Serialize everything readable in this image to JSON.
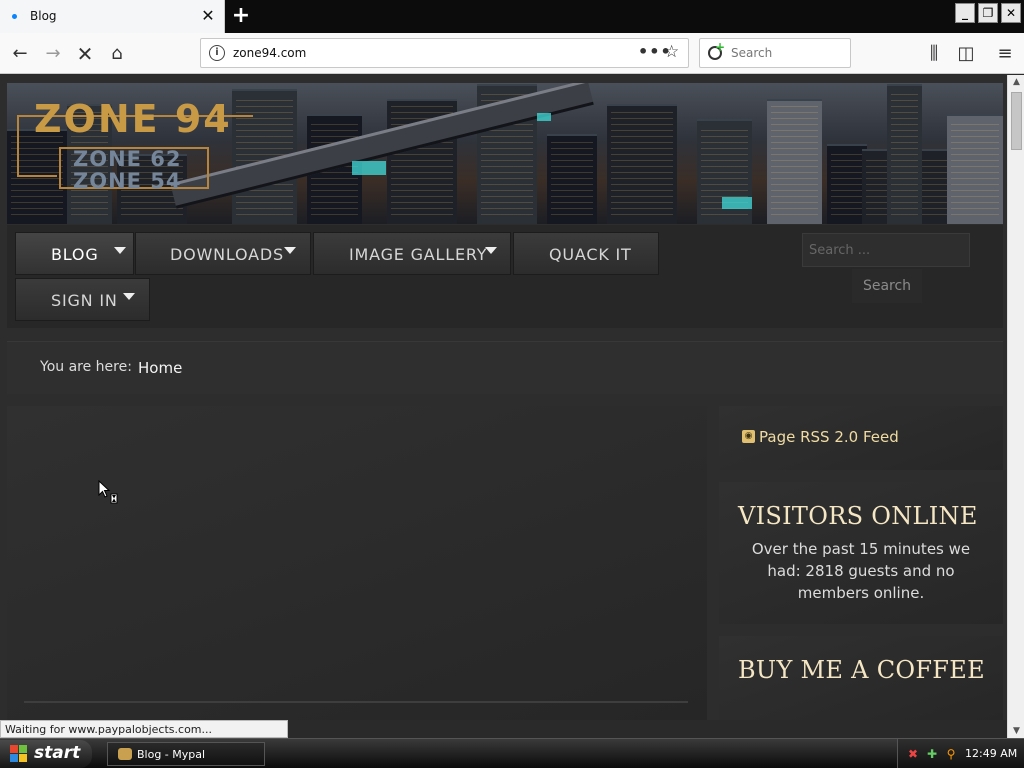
{
  "browser": {
    "tab_title": "Blog",
    "url": "zone94.com",
    "search_placeholder": "Search",
    "status_text": "Waiting for www.paypalobjects.com..."
  },
  "site": {
    "logo": {
      "main": "ZONE 94",
      "sub1": "ZONE 62",
      "sub2": "ZONE 54"
    },
    "menu": [
      {
        "label": "BLOG",
        "has_caret": true,
        "active": true
      },
      {
        "label": "DOWNLOADS",
        "has_caret": true
      },
      {
        "label": "IMAGE GALLERY",
        "has_caret": true
      },
      {
        "label": "QUACK IT",
        "has_caret": false
      },
      {
        "label": "SIGN IN",
        "has_caret": true
      }
    ],
    "search": {
      "placeholder": "Search ...",
      "button_label": "Search"
    },
    "breadcrumb": {
      "prefix": "You are here:",
      "current": "Home"
    },
    "sidebar": {
      "rss_label": "Page RSS 2.0 Feed",
      "visitors_title": "VISITORS ONLINE",
      "visitors_text": "Over the past 15 minutes we had: 2818 guests and no members online.",
      "coffee_title": "BUY ME A COFFEE"
    }
  },
  "taskbar": {
    "start_label": "start",
    "window_label": "Blog - Mypal",
    "clock": "12:49 AM"
  },
  "colors": {
    "page_bg": "#2d2d2d",
    "accent_gold": "#f0dba2",
    "logo_gold": "#c89a45"
  }
}
